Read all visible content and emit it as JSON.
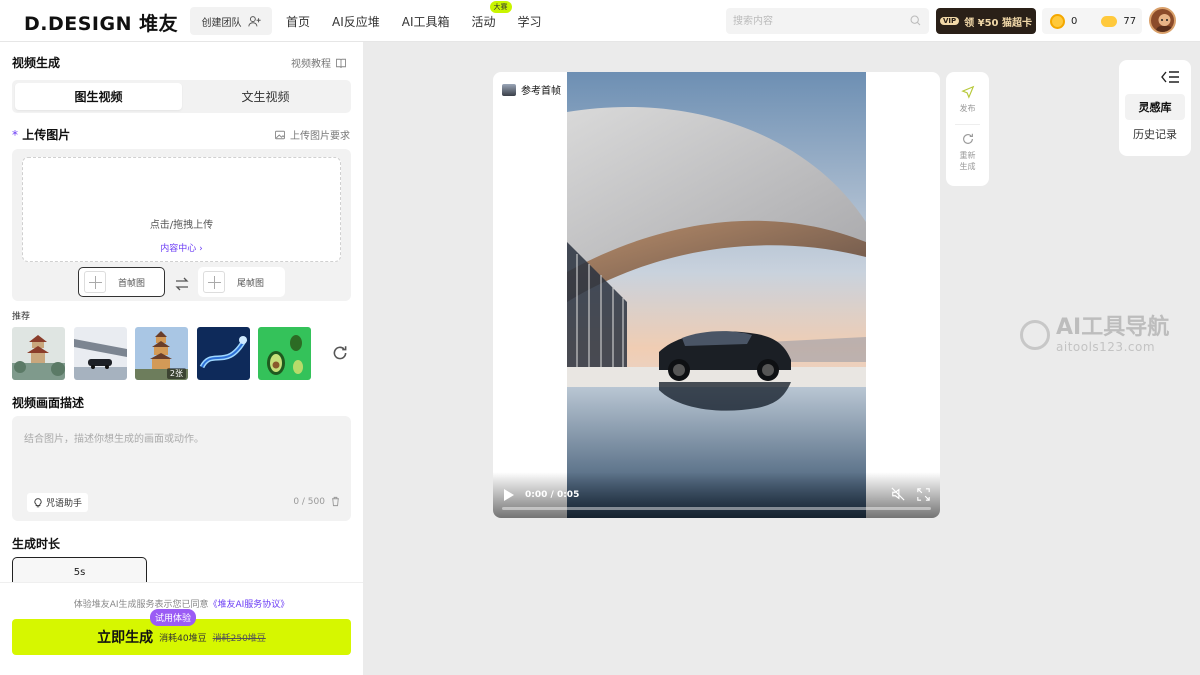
{
  "header": {
    "logo": "D.DESIGN 堆友",
    "create_team": "创建团队",
    "nav": [
      {
        "label": "首页"
      },
      {
        "label": "AI反应堆"
      },
      {
        "label": "AI工具箱"
      },
      {
        "label": "活动",
        "badge": "大赛"
      },
      {
        "label": "学习"
      }
    ],
    "search_placeholder": "搜索内容",
    "vip_tag": "VIP",
    "vip_label": "领 ¥50 猫超卡",
    "coins": "0",
    "beans": "77"
  },
  "left": {
    "section_title": "视频生成",
    "tutorial": "视频教程",
    "tabs": [
      "图生视频",
      "文生视频"
    ],
    "upload_title": "上传图片",
    "required_mark": "*",
    "upload_requirements": "上传图片要求",
    "drop_text": "点击/拖拽上传",
    "content_center": "内容中心 ›",
    "first_frame": "首帧图",
    "last_frame": "尾帧图",
    "recommend_label": "推荐",
    "thumb_count": "2张",
    "desc_title": "视频画面描述",
    "desc_placeholder": "结合图片，描述你想生成的画面或动作。",
    "spell_assistant": "咒语助手",
    "char_counter": "0 / 500",
    "duration_title": "生成时长",
    "duration_value": "5s",
    "agreement_prefix": "体验堆友AI生成服务表示您已同意",
    "agreement_link": "《堆友AI服务协议》",
    "trial_badge": "试用体验",
    "generate_label": "立即生成",
    "cost": "消耗40堆豆",
    "old_cost": "消耗250堆豆"
  },
  "preview": {
    "ref_label": "参考首帧",
    "timecode": "0:00 / 0:05",
    "progress": 0
  },
  "actions": {
    "publish": "发布",
    "regenerate_line1": "重新",
    "regenerate_line2": "生成"
  },
  "right_panel": {
    "tabs": [
      "灵感库",
      "历史记录"
    ]
  },
  "watermark": {
    "title": "AI工具导航",
    "url": "aitools123.com"
  },
  "colors": {
    "accent_lime": "#d6f700",
    "accent_purple": "#6b3cf5",
    "vip_dark": "#2a2018"
  }
}
